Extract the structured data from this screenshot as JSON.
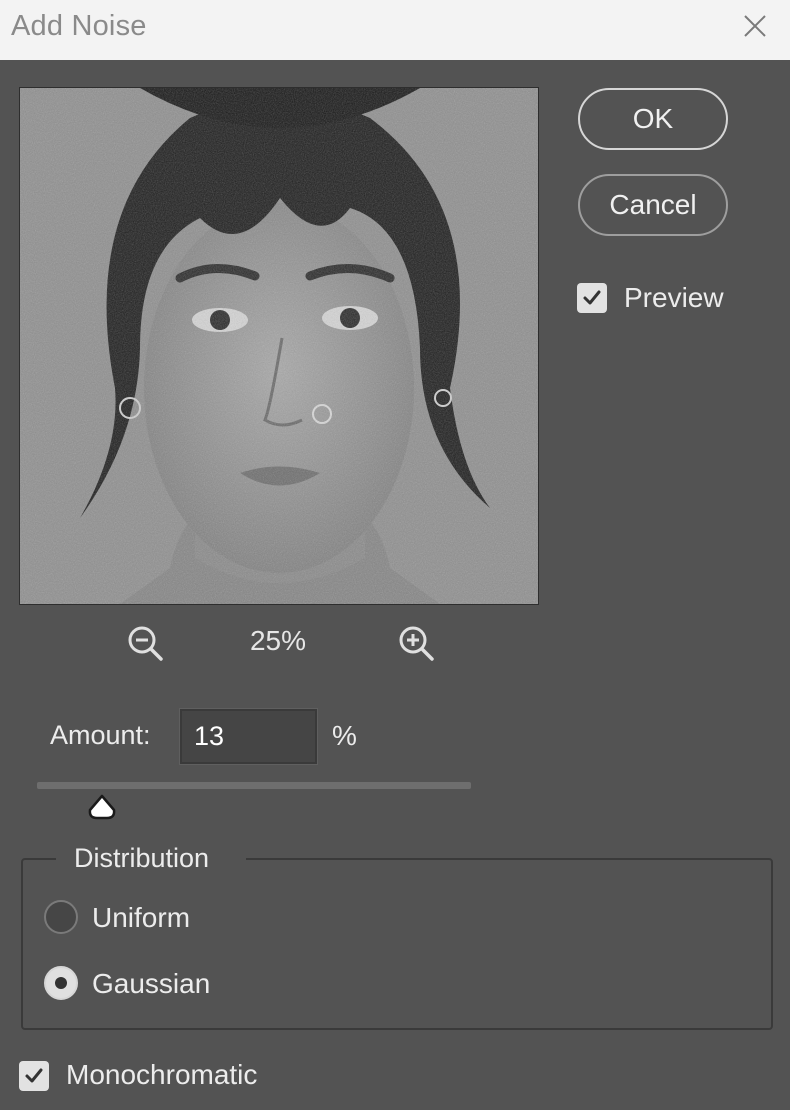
{
  "window": {
    "title": "Add Noise"
  },
  "icons": {
    "close": "close-icon",
    "zoom_out": "zoom-out-icon",
    "zoom_in": "zoom-in-icon",
    "check": "checkmark-icon"
  },
  "buttons": {
    "ok_label": "OK",
    "cancel_label": "Cancel"
  },
  "preview_toggle": {
    "label": "Preview",
    "checked": true
  },
  "zoom": {
    "level": "25%"
  },
  "amount": {
    "label": "Amount:",
    "value": "13",
    "unit": "%",
    "slider_fraction": 0.15
  },
  "distribution": {
    "legend": "Distribution",
    "options": [
      {
        "label": "Uniform",
        "selected": false
      },
      {
        "label": "Gaussian",
        "selected": true
      }
    ]
  },
  "monochromatic": {
    "label": "Monochromatic",
    "checked": true
  },
  "colors": {
    "dialog_bg": "#535353",
    "titlebar_bg": "#f3f3f3"
  }
}
